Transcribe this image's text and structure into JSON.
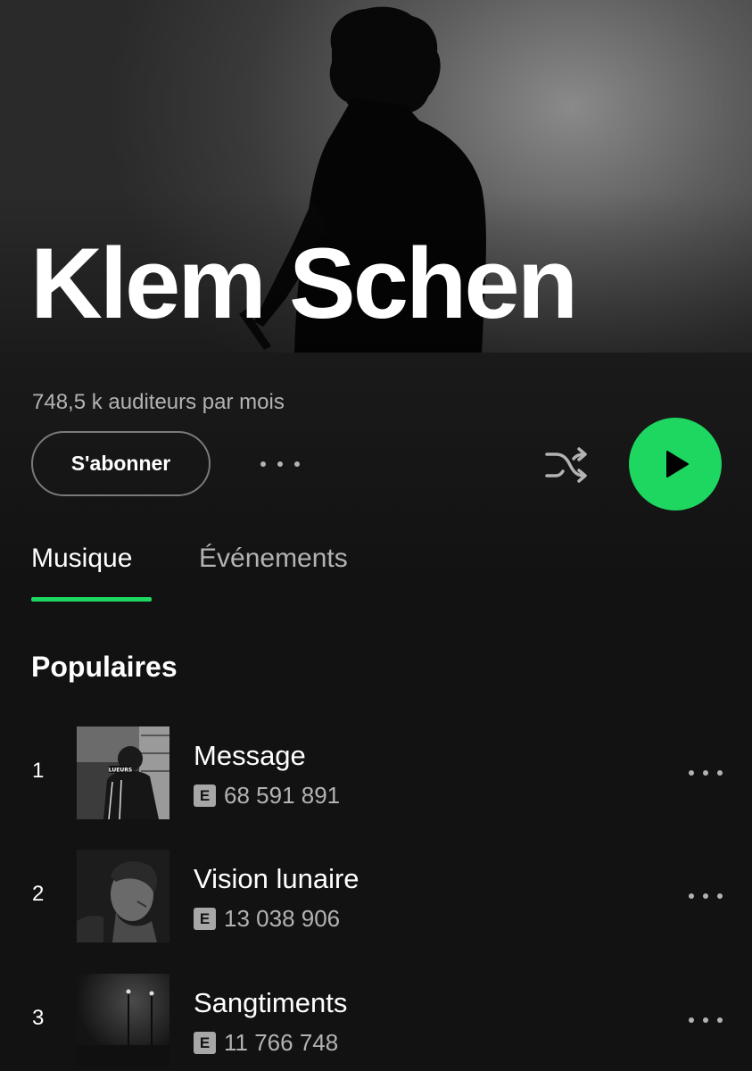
{
  "artist": {
    "name": "Klem Schen",
    "monthly_listeners": "748,5 k auditeurs par mois"
  },
  "actions": {
    "follow_label": "S'abonner",
    "more_icon": "more-horizontal-icon",
    "shuffle_icon": "shuffle-icon",
    "play_icon": "play-icon"
  },
  "tabs": [
    {
      "label": "Musique",
      "active": true
    },
    {
      "label": "Événements",
      "active": false
    }
  ],
  "popular": {
    "title": "Populaires",
    "tracks": [
      {
        "rank": "1",
        "title": "Message",
        "explicit": "E",
        "plays": "68 591 891",
        "cover_text": "LUEURS"
      },
      {
        "rank": "2",
        "title": "Vision lunaire",
        "explicit": "E",
        "plays": "13 038 906"
      },
      {
        "rank": "3",
        "title": "Sangtiments",
        "explicit": "E",
        "plays": "11 766 748"
      }
    ]
  },
  "colors": {
    "accent": "#1ed760",
    "background": "#121212",
    "secondary_text": "#b3b3b3"
  }
}
